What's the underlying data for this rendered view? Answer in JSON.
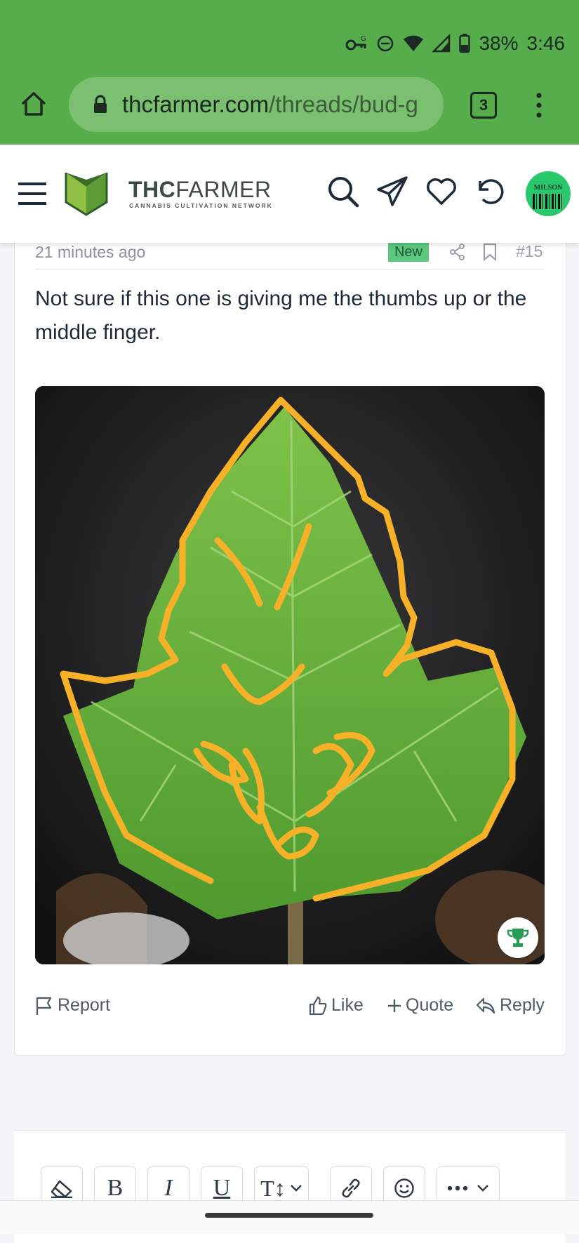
{
  "status_bar": {
    "battery": "38%",
    "time": "3:46"
  },
  "browser": {
    "url_main": "thcfarmer.com",
    "url_rest": "/threads/bud-g",
    "tab_count": "3"
  },
  "site": {
    "brand_bold": "THC",
    "brand_rest": "FARMER",
    "tagline": "CANNABIS CULTIVATION NETWORK",
    "avatar_text": "MILSON"
  },
  "post": {
    "time": "21 minutes ago",
    "badge": "New",
    "number": "#15",
    "message": "Not sure if this one is giving me the thumbs up or the middle finger.",
    "actions": {
      "report": "Report",
      "like": "Like",
      "quote": "Quote",
      "reply": "Reply"
    }
  },
  "editor_toolbar": {
    "bold": "B",
    "italic": "I",
    "underline": "U",
    "textsize": "T↕"
  },
  "colors": {
    "chrome": "#57ad4c",
    "badge": "#5cc77f",
    "annotation": "#f6b128",
    "leaf": "#6cb63c"
  }
}
